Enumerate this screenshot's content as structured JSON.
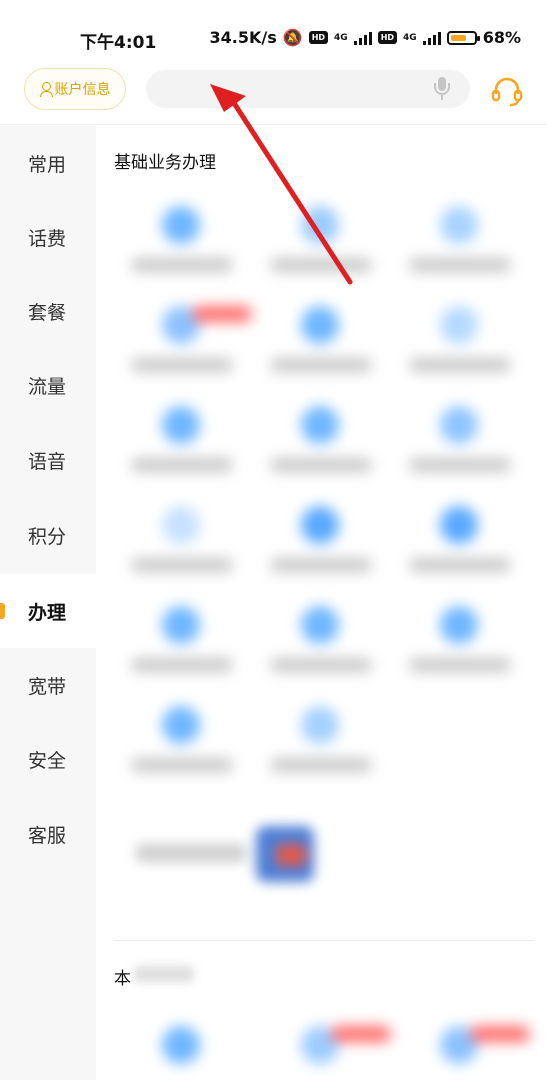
{
  "status_bar": {
    "time": "下午4:01",
    "net_speed": "34.5K/s",
    "hd1": "HD",
    "net1": "4G",
    "hd2": "HD",
    "net2": "4G",
    "battery_percent": "68%",
    "battery_level": 0.68
  },
  "header": {
    "account_label": "账户信息",
    "search_placeholder": ""
  },
  "sidebar": {
    "items": [
      {
        "label": "常用"
      },
      {
        "label": "话费"
      },
      {
        "label": "套餐"
      },
      {
        "label": "流量"
      },
      {
        "label": "语音"
      },
      {
        "label": "积分"
      },
      {
        "label": "办理",
        "active": true
      },
      {
        "label": "宽带"
      },
      {
        "label": "安全"
      },
      {
        "label": "客服"
      }
    ]
  },
  "content": {
    "section_title": "基础业务办理",
    "section2_char": "本"
  },
  "colors": {
    "accent": "#f5a623",
    "account_text": "#d9a300",
    "annotation_arrow": "#e02020",
    "blurred_icon": "#6fb6ff"
  },
  "icons": [
    "person-icon",
    "mic-icon",
    "headset-icon",
    "bell-slash-icon",
    "arrow-annotation-icon"
  ]
}
